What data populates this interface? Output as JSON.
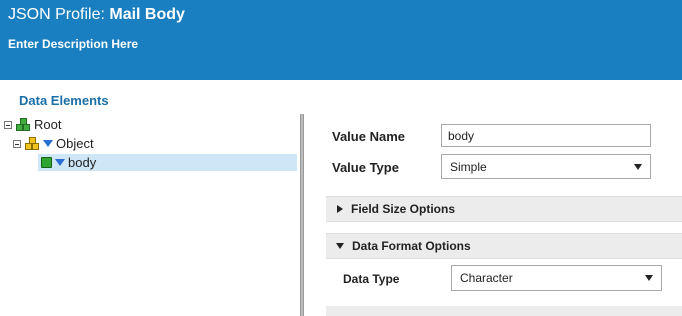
{
  "header": {
    "title_prefix": "JSON Profile: ",
    "title_name": "Mail Body",
    "description": "Enter Description Here"
  },
  "data_elements": {
    "title": "Data Elements",
    "tree": [
      {
        "label": "Root",
        "icon": "green-cubes-icon"
      },
      {
        "label": "Object",
        "icon": "yellow-cubes-icon"
      },
      {
        "label": "body",
        "icon": "green-cube-icon",
        "selected": true
      }
    ]
  },
  "form": {
    "value_name_label": "Value Name",
    "value_name": "body",
    "value_type_label": "Value Type",
    "value_type": "Simple"
  },
  "sections": {
    "field_size": "Field Size Options",
    "data_format": "Data Format Options"
  },
  "data_format": {
    "data_type_label": "Data Type",
    "data_type": "Character"
  },
  "colors": {
    "header_bg": "#1a7fc1",
    "section_title": "#1a6fa8",
    "selection_bg": "#cfe6f7"
  }
}
